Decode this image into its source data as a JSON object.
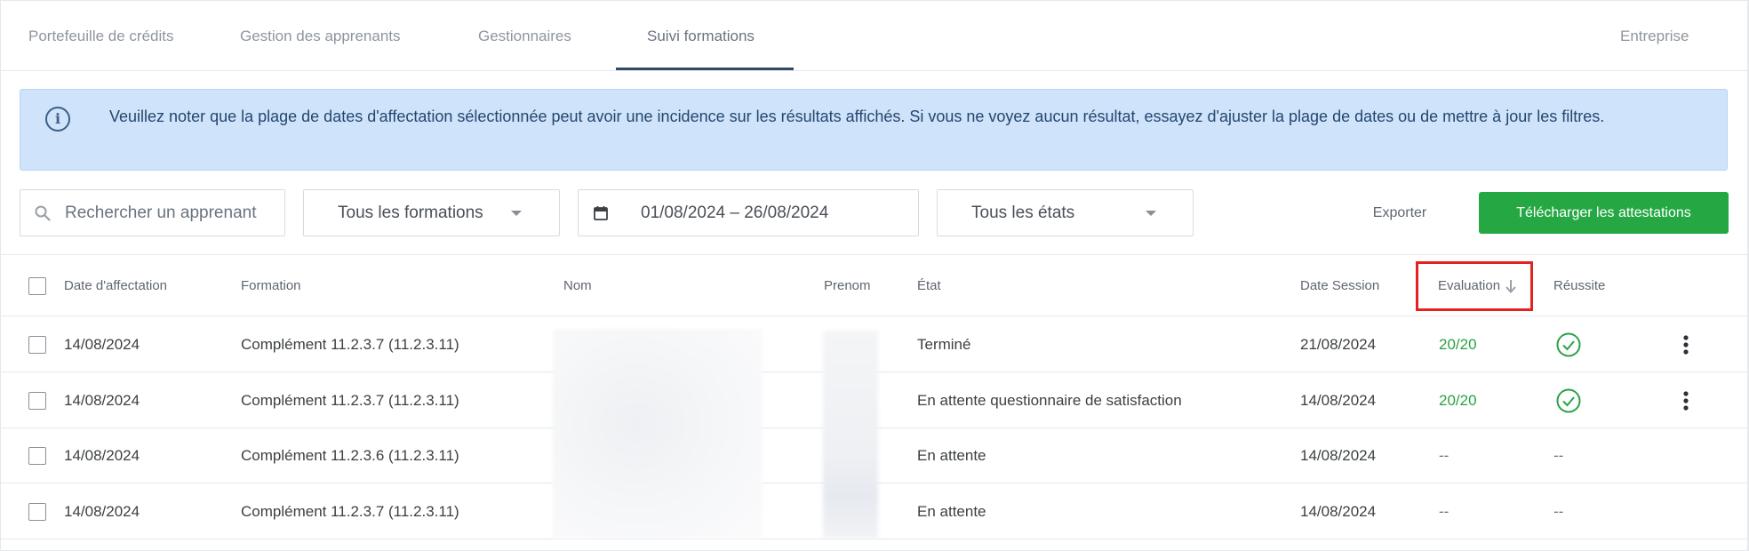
{
  "tabs": [
    {
      "label": "Portefeuille de crédits",
      "active": false
    },
    {
      "label": "Gestion des apprenants",
      "active": false
    },
    {
      "label": "Gestionnaires",
      "active": false
    },
    {
      "label": "Suivi formations",
      "active": true
    }
  ],
  "company_tab": "Entreprise",
  "banner": {
    "icon": "info-icon",
    "text": "Veuillez noter que la plage de dates d'affectation sélectionnée peut avoir une incidence sur les résultats affichés. Si vous ne voyez aucun résultat, essayez d'ajuster la plage de dates ou de mettre à jour les filtres."
  },
  "filters": {
    "search_placeholder": "Rechercher un apprenant",
    "formation_select": "Tous les formations",
    "date_range": "01/08/2024 – 26/08/2024",
    "state_select": "Tous les états",
    "export_label": "Exporter",
    "download_label": "Télécharger les attestations"
  },
  "table": {
    "headers": {
      "date_affectation": "Date d'affectation",
      "formation": "Formation",
      "nom": "Nom",
      "prenom": "Prenom",
      "etat": "État",
      "date_session": "Date Session",
      "evaluation": "Evaluation",
      "reussite": "Réussite"
    },
    "sorted_column": "evaluation",
    "sort_direction": "descending",
    "rows": [
      {
        "date_affectation": "14/08/2024",
        "formation": "Complément 11.2.3.7 (11.2.3.11)",
        "etat": "Terminé",
        "date_session": "21/08/2024",
        "evaluation": "20/20",
        "reussite": "check-circle-icon"
      },
      {
        "date_affectation": "14/08/2024",
        "formation": "Complément 11.2.3.7 (11.2.3.11)",
        "etat": "En attente questionnaire de satisfaction",
        "date_session": "14/08/2024",
        "evaluation": "20/20",
        "reussite": "check-circle-icon"
      },
      {
        "date_affectation": "14/08/2024",
        "formation": "Complément 11.2.3.6 (11.2.3.11)",
        "etat": "En attente",
        "date_session": "14/08/2024",
        "evaluation": "--",
        "reussite": "--"
      },
      {
        "date_affectation": "14/08/2024",
        "formation": "Complément 11.2.3.7 (11.2.3.11)",
        "etat": "En attente",
        "date_session": "14/08/2024",
        "evaluation": "--",
        "reussite": "--"
      }
    ]
  },
  "colors": {
    "accent_green": "#25a844",
    "banner_bg": "#cfe3fb",
    "tab_underline": "#2f4a68",
    "highlight_box": "#e52222"
  }
}
